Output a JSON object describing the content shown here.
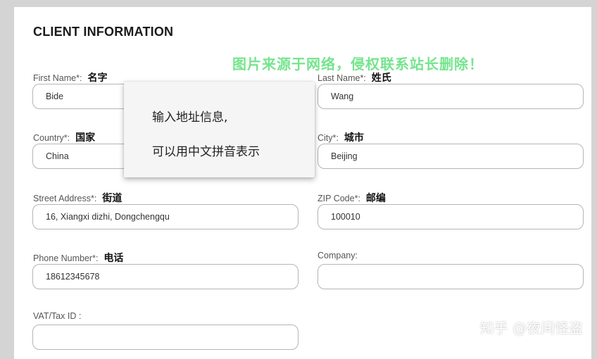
{
  "form": {
    "title": "CLIENT INFORMATION",
    "fields": {
      "first_name": {
        "label": "First Name*:",
        "cn": "名字",
        "value": "Bide"
      },
      "last_name": {
        "label": "Last Name*:",
        "cn": "姓氏",
        "value": "Wang"
      },
      "country": {
        "label": "Country*:",
        "cn": "国家",
        "value": "China"
      },
      "city": {
        "label": "City*:",
        "cn": "城市",
        "value": "Beijing"
      },
      "street": {
        "label": "Street Address*:",
        "cn": "街道",
        "value": "16, Xiangxi dizhi, Dongchengqu"
      },
      "zip": {
        "label": "ZIP Code*:",
        "cn": "邮编",
        "value": "100010"
      },
      "phone": {
        "label": "Phone Number*:",
        "cn": "电话",
        "value": "18612345678"
      },
      "company": {
        "label": "Company:",
        "value": ""
      },
      "vat": {
        "label": "VAT/Tax ID :",
        "value": ""
      }
    }
  },
  "popup": {
    "line1": "输入地址信息,",
    "line2": "可以用中文拼音表示"
  },
  "watermark": "图片来源于网络，侵权联系站长删除！",
  "credit": "知乎 @夜间怪盗",
  "colors": {
    "background": "#d4d4d4",
    "field_border": "#b5b5b5",
    "watermark": "#5ee07a"
  }
}
